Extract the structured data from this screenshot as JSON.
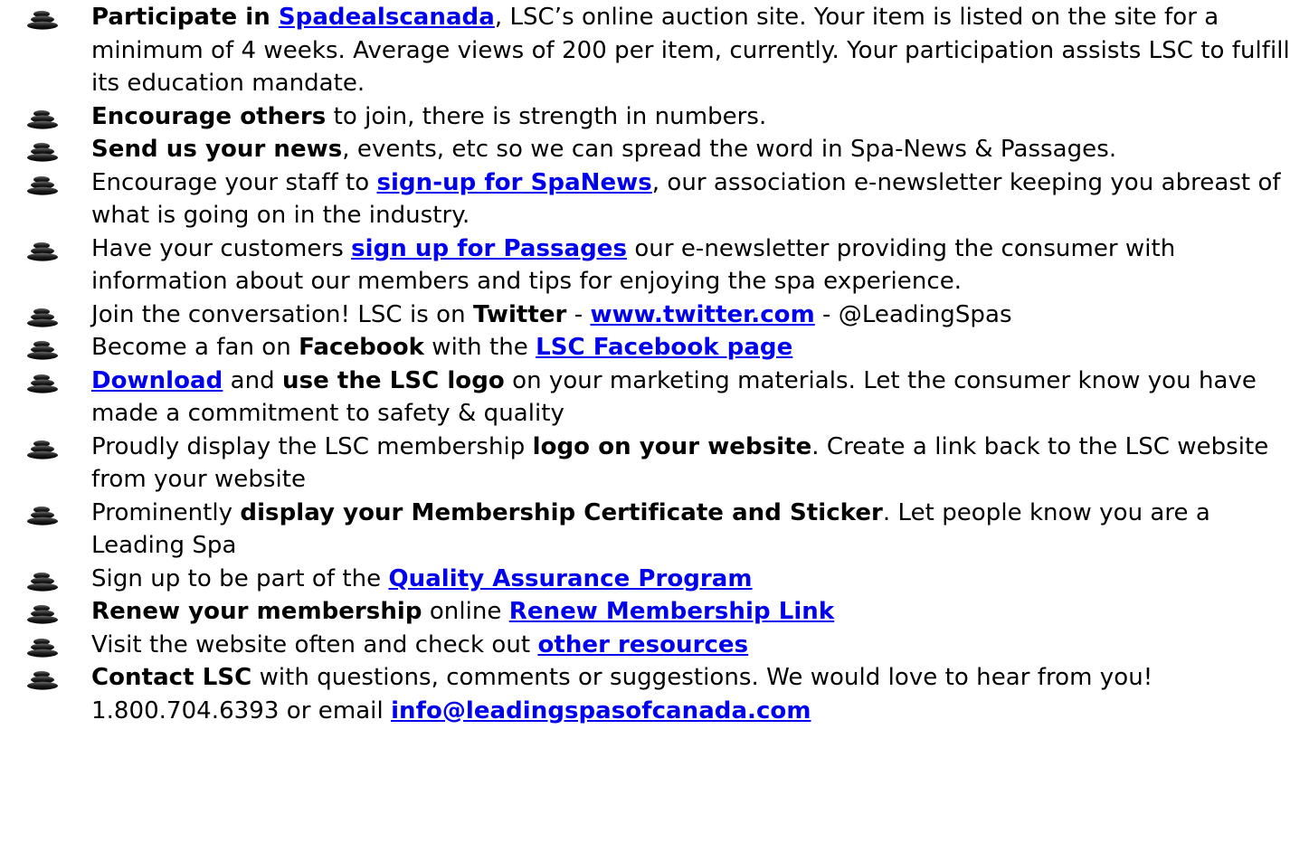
{
  "bullet_icon": "stacked-stones-icon",
  "colors": {
    "text": "#000000",
    "link": "#0000ee",
    "background": "#ffffff"
  },
  "items": [
    {
      "name": "participate-spadealscanada",
      "segments": [
        {
          "text": "Participate in ",
          "style": "bold"
        },
        {
          "text": "Spadealscanada",
          "style": "link"
        },
        {
          "text": ", LSC’s online auction site. Your item is listed on the site for a minimum of 4 weeks. Average views of 200 per item, currently. Your participation assists LSC to fulfill its education mandate.",
          "style": "normal"
        }
      ]
    },
    {
      "name": "encourage-others",
      "segments": [
        {
          "text": "Encourage others",
          "style": "bold"
        },
        {
          "text": " to join, there is strength in numbers.",
          "style": "normal"
        }
      ]
    },
    {
      "name": "send-news",
      "segments": [
        {
          "text": "Send us your news",
          "style": "bold"
        },
        {
          "text": ", events, etc so we can spread the word in Spa-News & Passages.",
          "style": "normal"
        }
      ]
    },
    {
      "name": "staff-spanews",
      "segments": [
        {
          "text": "Encourage your staff to ",
          "style": "normal"
        },
        {
          "text": "sign-up for SpaNews",
          "style": "link"
        },
        {
          "text": ", our association e-newsletter keeping you abreast of what is going on in the industry.",
          "style": "normal"
        }
      ]
    },
    {
      "name": "customers-passages",
      "segments": [
        {
          "text": "Have your customers ",
          "style": "normal"
        },
        {
          "text": "sign up for Passages",
          "style": "link"
        },
        {
          "text": " our e-newsletter providing the consumer with information about our members and tips for enjoying the spa experience.",
          "style": "normal"
        }
      ]
    },
    {
      "name": "twitter",
      "segments": [
        {
          "text": "Join the conversation! LSC is on ",
          "style": "normal"
        },
        {
          "text": "Twitter",
          "style": "bold"
        },
        {
          "text": " - ",
          "style": "normal"
        },
        {
          "text": "www.twitter.com",
          "style": "link"
        },
        {
          "text": " - @LeadingSpas",
          "style": "normal"
        }
      ]
    },
    {
      "name": "facebook",
      "segments": [
        {
          "text": "Become a fan on ",
          "style": "normal"
        },
        {
          "text": "Facebook",
          "style": "bold"
        },
        {
          "text": " with the ",
          "style": "normal"
        },
        {
          "text": "LSC Facebook page",
          "style": "link"
        }
      ]
    },
    {
      "name": "download-logo",
      "segments": [
        {
          "text": "Download",
          "style": "link"
        },
        {
          "text": " and ",
          "style": "normal"
        },
        {
          "text": "use the LSC logo",
          "style": "bold"
        },
        {
          "text": " on your marketing materials. Let the consumer know you have made a commitment to safety & quality",
          "style": "normal"
        }
      ]
    },
    {
      "name": "logo-on-website",
      "segments": [
        {
          "text": "Proudly display the LSC membership ",
          "style": "normal"
        },
        {
          "text": "logo on your website",
          "style": "bold"
        },
        {
          "text": ". Create a link back to the LSC website from your website",
          "style": "normal"
        }
      ]
    },
    {
      "name": "display-certificate",
      "segments": [
        {
          "text": "Prominently ",
          "style": "normal"
        },
        {
          "text": "display your Membership Certificate and Sticker",
          "style": "bold"
        },
        {
          "text": ". Let people know you are a Leading Spa",
          "style": "normal"
        }
      ]
    },
    {
      "name": "quality-assurance",
      "segments": [
        {
          "text": "Sign up to be part of the ",
          "style": "normal"
        },
        {
          "text": "Quality Assurance Program",
          "style": "link"
        }
      ]
    },
    {
      "name": "renew-membership",
      "segments": [
        {
          "text": "Renew your membership",
          "style": "bold"
        },
        {
          "text": " online ",
          "style": "normal"
        },
        {
          "text": "Renew Membership Link",
          "style": "link"
        }
      ]
    },
    {
      "name": "other-resources",
      "segments": [
        {
          "text": "Visit the website often and check out ",
          "style": "normal"
        },
        {
          "text": "other resources",
          "style": "link"
        }
      ]
    },
    {
      "name": "contact-lsc",
      "segments": [
        {
          "text": "Contact LSC",
          "style": "bold"
        },
        {
          "text": " with questions, comments or suggestions.  We would love to hear from you! 1.800.704.6393 or email ",
          "style": "normal"
        },
        {
          "text": "info@leadingspasofcanada.com",
          "style": "link"
        }
      ]
    }
  ]
}
